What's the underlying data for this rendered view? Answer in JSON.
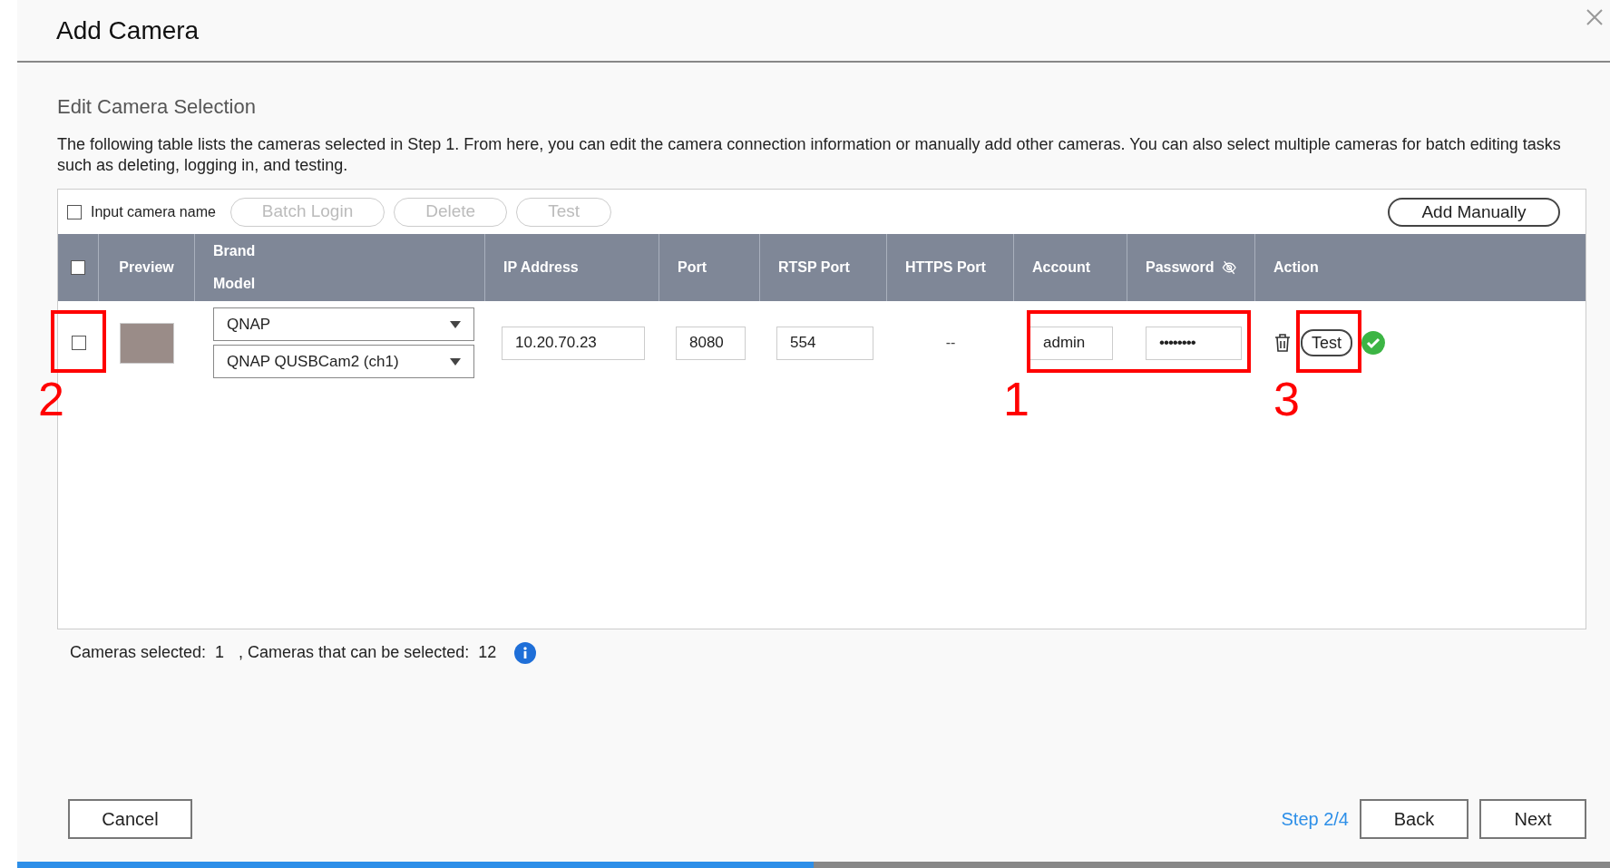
{
  "dialog": {
    "title": "Add Camera"
  },
  "section": {
    "title": "Edit Camera Selection",
    "description": "The following table lists the cameras selected in Step 1. From here, you can edit the camera connection information or manually add other cameras. You can also select multiple cameras for batch editing tasks such as deleting, logging in, and testing."
  },
  "toolbar": {
    "name_checkbox": {
      "label": "Input camera name",
      "checked": false
    },
    "buttons": [
      {
        "label": "Batch Login",
        "disabled": true
      },
      {
        "label": "Delete",
        "disabled": true
      },
      {
        "label": "Test",
        "disabled": true
      }
    ],
    "add_button": "Add Manually"
  },
  "table": {
    "select_all_checked": false,
    "columns": [
      "Preview",
      "Brand",
      "Model",
      "IP Address",
      "Port",
      "RTSP Port",
      "HTTPS Port",
      "Account",
      "Password",
      "Action"
    ],
    "rows": [
      {
        "checked": false,
        "brand": "QNAP",
        "model": "QNAP QUSBCam2 (ch1)",
        "ip": "10.20.70.23",
        "port": "8080",
        "rtsp_port": "554",
        "https_port": "--",
        "account": "admin",
        "password": "••••••••",
        "test_button": "Test",
        "test_ok": true
      }
    ]
  },
  "annotations": [
    "2",
    "1",
    "3"
  ],
  "footer": {
    "selected_label": "Cameras selected:",
    "selected": "1",
    "selectable_label": ", Cameras that can be selected:",
    "selectable": "12"
  },
  "buttons": {
    "cancel": "Cancel",
    "step": "Step 2/4",
    "back": "Back",
    "next": "Next"
  },
  "progress": {
    "level": 0.5
  }
}
